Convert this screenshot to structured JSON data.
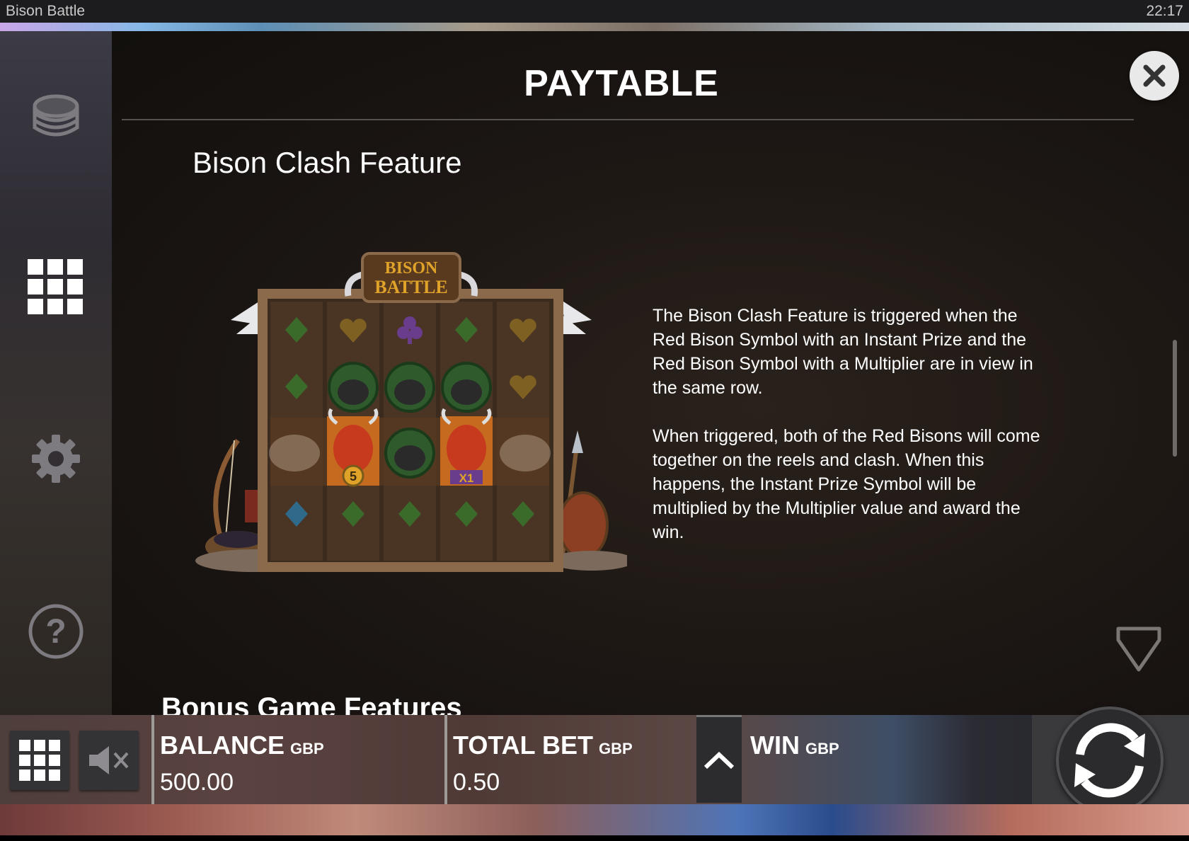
{
  "status_bar": {
    "app_title": "Bison Battle",
    "time": "22:17"
  },
  "side_menu": {
    "items": [
      {
        "icon": "coins-stack-icon"
      },
      {
        "icon": "grid-menu-icon"
      },
      {
        "icon": "gear-icon"
      },
      {
        "icon": "help-icon"
      }
    ]
  },
  "paytable": {
    "title": "PAYTABLE",
    "section_title": "Bison Clash Feature",
    "image_logo_text": "BISON BATTLE",
    "paragraphs": [
      "The Bison Clash Feature is triggered when the Red Bison Symbol with an Instant Prize and the Red Bison Symbol with a Multiplier are in view in the same row.",
      "When triggered, both of the Red Bisons will come together on the reels and clash. When this happens, the Instant Prize Symbol will be multiplied by the Multiplier value and award the win."
    ],
    "next_section_title": "Bonus Game Features",
    "prize_badge": "5",
    "multiplier_badge": "X1"
  },
  "bottom_bar": {
    "balance": {
      "label": "BALANCE",
      "currency": "GBP",
      "value": "500.00"
    },
    "total_bet": {
      "label": "TOTAL BET",
      "currency": "GBP",
      "value": "0.50"
    },
    "win": {
      "label": "WIN",
      "currency": "GBP",
      "value": ""
    }
  },
  "colors": {
    "accent_gold": "#e0a32a",
    "panel_bg": "#1b1613",
    "bison_red": "#c83a1e",
    "card_green": "#3b6b2a"
  }
}
